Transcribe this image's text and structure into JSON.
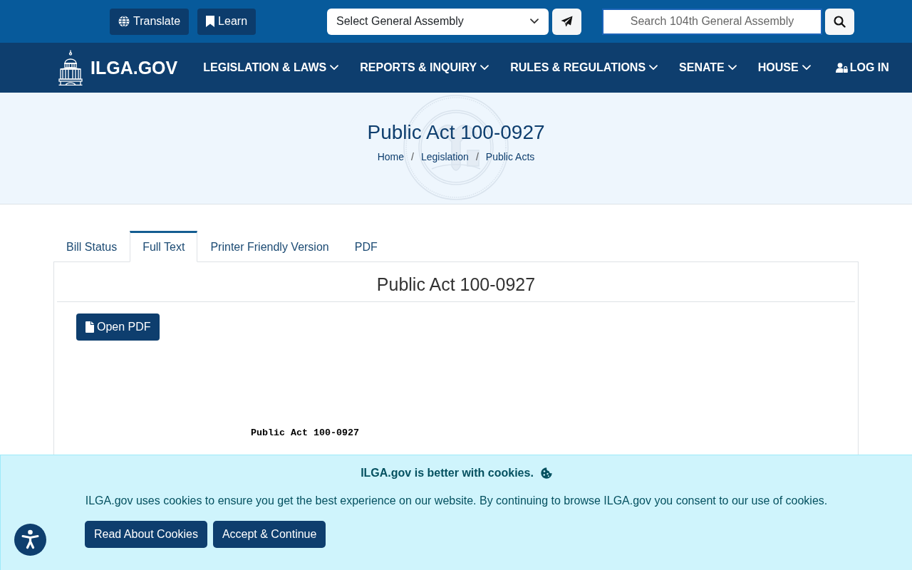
{
  "top_bar": {
    "buttons": [
      {
        "label": "Translate"
      },
      {
        "label": "Learn"
      }
    ],
    "assembly_select": {
      "value": "Select General Assembly"
    },
    "search": {
      "placeholder": "Search 104th General Assembly"
    }
  },
  "nav": {
    "logo": "ILGA.GOV",
    "items": [
      {
        "label": "LEGISLATION & LAWS",
        "kind": "dropdown"
      },
      {
        "label": "REPORTS & INQUIRY",
        "kind": "dropdown"
      },
      {
        "label": "RULES & REGULATIONS",
        "kind": "dropdown"
      },
      {
        "label": "SENATE",
        "kind": "dropdown"
      },
      {
        "label": "HOUSE",
        "kind": "dropdown"
      },
      {
        "label": "LOG IN",
        "kind": "login"
      }
    ]
  },
  "hero": {
    "title": "Public Act 100-0927",
    "breadcrumb": [
      {
        "kind": "link",
        "label": "Home"
      },
      {
        "kind": "separator",
        "label": "/"
      },
      {
        "kind": "link",
        "label": "Legislation"
      },
      {
        "kind": "separator",
        "label": "/"
      },
      {
        "kind": "link",
        "label": "Public Acts"
      }
    ]
  },
  "tabs": [
    {
      "label": "Bill Status",
      "selected": false
    },
    {
      "label": "Full Text",
      "selected": true
    },
    {
      "label": "Printer Friendly Version",
      "selected": false
    },
    {
      "label": "PDF",
      "selected": false
    }
  ],
  "document": {
    "title": "Public Act 100-0927",
    "open_pdf_button": "Open PDF",
    "text_heading": "Public Act 100-0927"
  },
  "cookie_banner": {
    "title": "ILGA.gov is better with cookies.",
    "message": "ILGA.gov uses cookies to ensure you get the best experience on our website. By continuing to browse ILGA.gov you consent to our use of cookies.",
    "buttons": [
      "Read About Cookies",
      "Accept & Continue"
    ]
  }
}
